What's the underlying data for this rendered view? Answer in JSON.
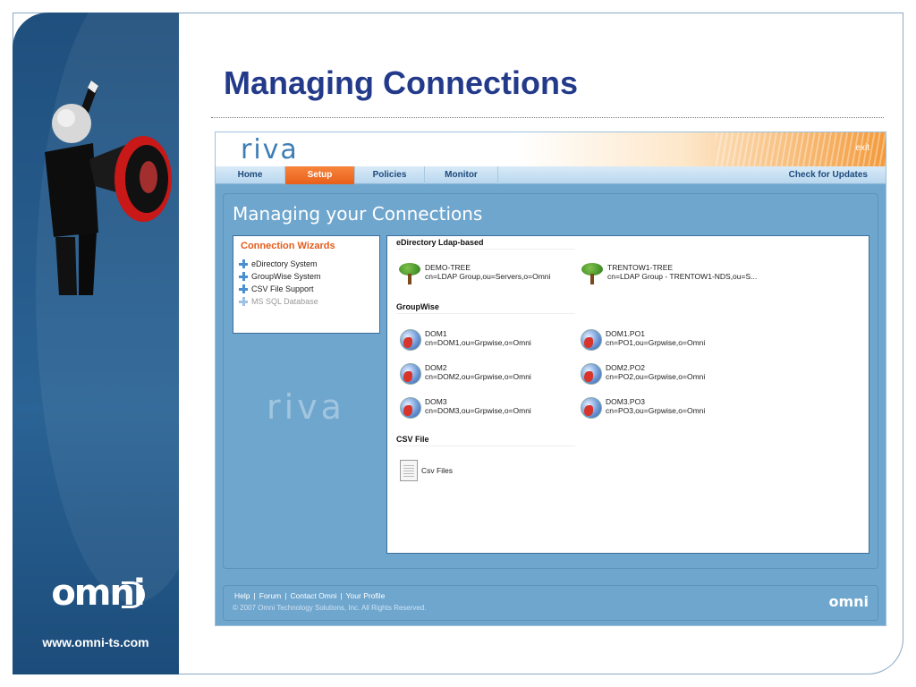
{
  "slide": {
    "title": "Managing Connections",
    "brand_logo": "omni",
    "brand_url": "www.omni-ts.com"
  },
  "app": {
    "logo": "riva",
    "exit_label": "exit",
    "nav": {
      "items": [
        {
          "label": "Home",
          "active": false
        },
        {
          "label": "Setup",
          "active": true
        },
        {
          "label": "Policies",
          "active": false
        },
        {
          "label": "Monitor",
          "active": false
        }
      ],
      "updates_label": "Check for Updates"
    },
    "content_title": "Managing your Connections",
    "wizards": {
      "title": "Connection Wizards",
      "items": [
        {
          "label": "eDirectory System",
          "enabled": true,
          "icon": "plus-icon"
        },
        {
          "label": "GroupWise System",
          "enabled": true,
          "icon": "plus-icon"
        },
        {
          "label": "CSV File Support",
          "enabled": true,
          "icon": "plus-icon"
        },
        {
          "label": "MS SQL Database",
          "enabled": false,
          "icon": "plus-icon"
        }
      ]
    },
    "watermark": "riva",
    "connections": {
      "edirectory": {
        "header": "eDirectory Ldap-based",
        "items": [
          {
            "name": "DEMO-TREE",
            "dn": "cn=LDAP Group,ou=Servers,o=Omni",
            "icon": "tree-icon"
          },
          {
            "name": "TRENTOW1-TREE",
            "dn": "cn=LDAP Group - TRENTOW1-NDS,ou=S...",
            "icon": "tree-icon"
          }
        ]
      },
      "groupwise": {
        "header": "GroupWise",
        "items": [
          {
            "name": "DOM1",
            "dn": "cn=DOM1,ou=Grpwise,o=Omni",
            "icon": "globe-icon"
          },
          {
            "name": "DOM1.PO1",
            "dn": "cn=PO1,ou=Grpwise,o=Omni",
            "icon": "globe-icon"
          },
          {
            "name": "DOM2",
            "dn": "cn=DOM2,ou=Grpwise,o=Omni",
            "icon": "globe-icon"
          },
          {
            "name": "DOM2.PO2",
            "dn": "cn=PO2,ou=Grpwise,o=Omni",
            "icon": "globe-icon"
          },
          {
            "name": "DOM3",
            "dn": "cn=DOM3,ou=Grpwise,o=Omni",
            "icon": "globe-icon"
          },
          {
            "name": "DOM3.PO3",
            "dn": "cn=PO3,ou=Grpwise,o=Omni",
            "icon": "globe-icon"
          }
        ]
      },
      "csv": {
        "header": "CSV File",
        "items": [
          {
            "name": "Csv Files",
            "icon": "file-icon"
          }
        ]
      }
    },
    "footer": {
      "links": [
        "Help",
        "Forum",
        "Contact Omni",
        "Your Profile"
      ],
      "separator": "|",
      "copyright": "© 2007 Omni Technology Solutions, Inc.   All Rights Reserved.",
      "logo": "omni"
    }
  }
}
